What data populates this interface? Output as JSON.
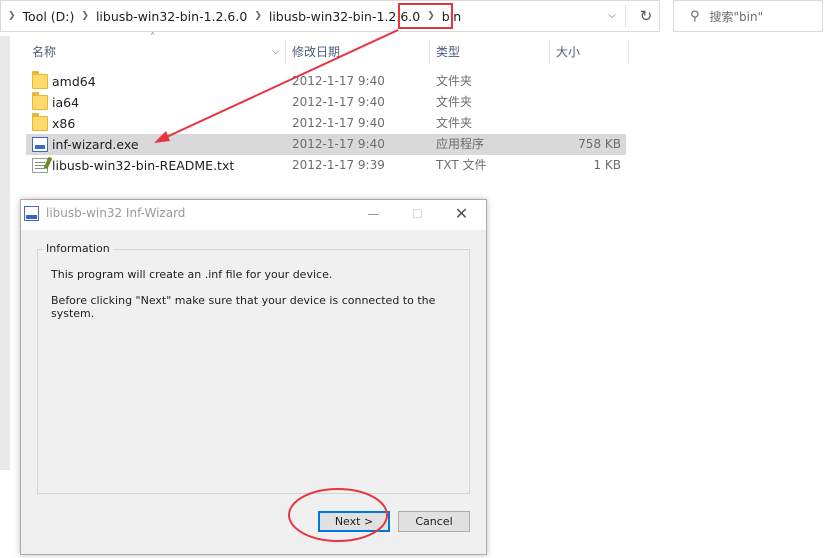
{
  "address_bar": {
    "crumbs": [
      "Tool (D:)",
      "libusb-win32-bin-1.2.6.0",
      "libusb-win32-bin-1.2.6.0",
      "bin"
    ]
  },
  "search": {
    "placeholder": "搜索\"bin\""
  },
  "columns": {
    "name": "名称",
    "modified": "修改日期",
    "type": "类型",
    "size": "大小"
  },
  "files": [
    {
      "name": "amd64",
      "modified": "2012-1-17 9:40",
      "type": "文件夹",
      "size": "",
      "icon": "folder-icon"
    },
    {
      "name": "ia64",
      "modified": "2012-1-17 9:40",
      "type": "文件夹",
      "size": "",
      "icon": "folder-icon"
    },
    {
      "name": "x86",
      "modified": "2012-1-17 9:40",
      "type": "文件夹",
      "size": "",
      "icon": "folder-icon"
    },
    {
      "name": "inf-wizard.exe",
      "modified": "2012-1-17 9:40",
      "type": "应用程序",
      "size": "758 KB",
      "icon": "exe-icon",
      "selected": true
    },
    {
      "name": "libusb-win32-bin-README.txt",
      "modified": "2012-1-17 9:39",
      "type": "TXT 文件",
      "size": "1 KB",
      "icon": "text-file-icon"
    }
  ],
  "dialog": {
    "title": "libusb-win32 Inf-Wizard",
    "group_label": "Information",
    "line1": "This program will create an .inf file for your device.",
    "line2": "Before clicking \"Next\" make sure that your device is connected to the system.",
    "next_label": "Next >",
    "cancel_label": "Cancel"
  },
  "annotation_color": "#e8343f"
}
